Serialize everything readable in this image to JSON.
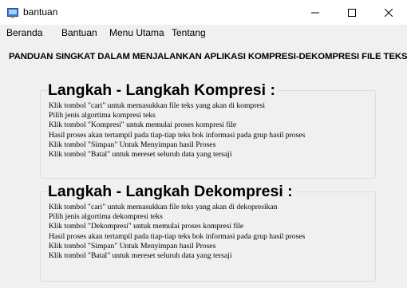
{
  "window": {
    "title": "bantuan",
    "icon": "app-icon",
    "controls": {
      "minimize_icon": "minimize-icon",
      "maximize_icon": "maximize-icon",
      "close_icon": "close-icon"
    }
  },
  "menu": {
    "items": [
      {
        "label": "Beranda"
      },
      {
        "label": "Bantuan"
      },
      {
        "label": "Menu Utama"
      },
      {
        "label": "Tentang"
      }
    ]
  },
  "heading": "PANDUAN SINGKAT DALAM MENJALANKAN APLIKASI KOMPRESI-DEKOMPRESI FILE TEKS",
  "compression": {
    "title": "Langkah - Langkah Kompresi :",
    "lines": [
      "Klik tombol \"cari\" untuk memasukkan file teks yang akan di kompresi",
      "Pilih jenis algortima kompresi teks",
      "Klik tombol \"Kompresi\" untuk memulai proses kompresi file",
      "Hasil proses akan tertampil pada tiap-tiap teks bok informasi pada grup hasil proses",
      "Klik tombol \"Simpan\" Untuk Menyimpan hasil Proses",
      "Klik tombol \"Batal\" untuk mereset seluruh data yang tersaji"
    ]
  },
  "decompression": {
    "title": "Langkah - Langkah Dekompresi :",
    "lines": [
      "Klik tombol \"cari\" untuk memasukkan file teks yang akan di dekopresikan",
      "Pilih jenis algortima dekompresi teks",
      "Klik tombol \"Dekompresi\" untuk memulai proses kompresi file",
      "Hasil proses akan tertampil pada tiap-tiap teks bok informasi pada grup hasil proses",
      "Klik tombol \"Simpan\" Untuk Menyimpan hasil Proses",
      "Klik tombol \"Batal\" untuk mereset seluruh data yang tersaji"
    ]
  }
}
